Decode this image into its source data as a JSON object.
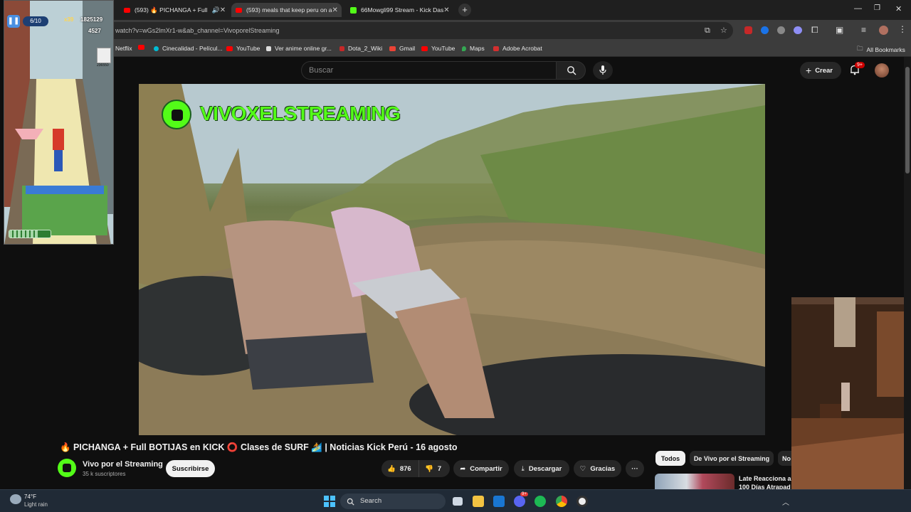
{
  "browser": {
    "tabs": [
      {
        "label": "(593) 🔥 PICHANGA + Full",
        "active": false,
        "favicon_color": "#ff0000"
      },
      {
        "label": "(593) meals that keep peru on a",
        "active": true,
        "favicon_color": "#ff0000"
      },
      {
        "label": "66Mowgli99 Stream - Kick Das",
        "active": false,
        "favicon_color": "#53fc18"
      }
    ],
    "url": "watch?v=wGs2lmXr1-w&ab_channel=VivoporelStreaming",
    "bookmarks": [
      "Netflix",
      "",
      "Cinecalidad - Películ...",
      "YouTube",
      "Ver anime online gr...",
      "Dota_2_Wiki",
      "Gmail",
      "YouTube",
      "Maps",
      "Adobe Acrobat"
    ],
    "all_bookmarks": "All Bookmarks"
  },
  "youtube": {
    "search_placeholder": "Buscar",
    "create_label": "Crear",
    "notification_count": "9+",
    "video": {
      "watermark": "VIVOXELSTREAMING",
      "title": "🔥 PICHANGA + Full BOTIJAS en KICK ⭕ Clases de SURF 🏄 | Noticias Kick Perú - 16 agosto",
      "channel": "Vivo por el Streaming",
      "subscribers": "35 k suscriptores",
      "subscribe_label": "Suscribirse",
      "likes": "876",
      "dislikes": "7",
      "share_label": "Compartir",
      "download_label": "Descargar",
      "thanks_label": "Gracias",
      "more_label": "···"
    },
    "filter_chips": [
      "Todos",
      "De Vivo por el Streaming",
      "No"
    ],
    "recommended": {
      "title_line1": "Late Reacciona a",
      "title_line2": "100 Días Atrapad"
    }
  },
  "game_overlay": {
    "progress": "6/10",
    "multiplier": "x39",
    "score": "1825129",
    "coins": "4527",
    "player_score": "236550"
  },
  "taskbar": {
    "weather_temp": "74°F",
    "weather_desc": "Light rain",
    "search_label": "Search",
    "discord_badge": "9+"
  }
}
